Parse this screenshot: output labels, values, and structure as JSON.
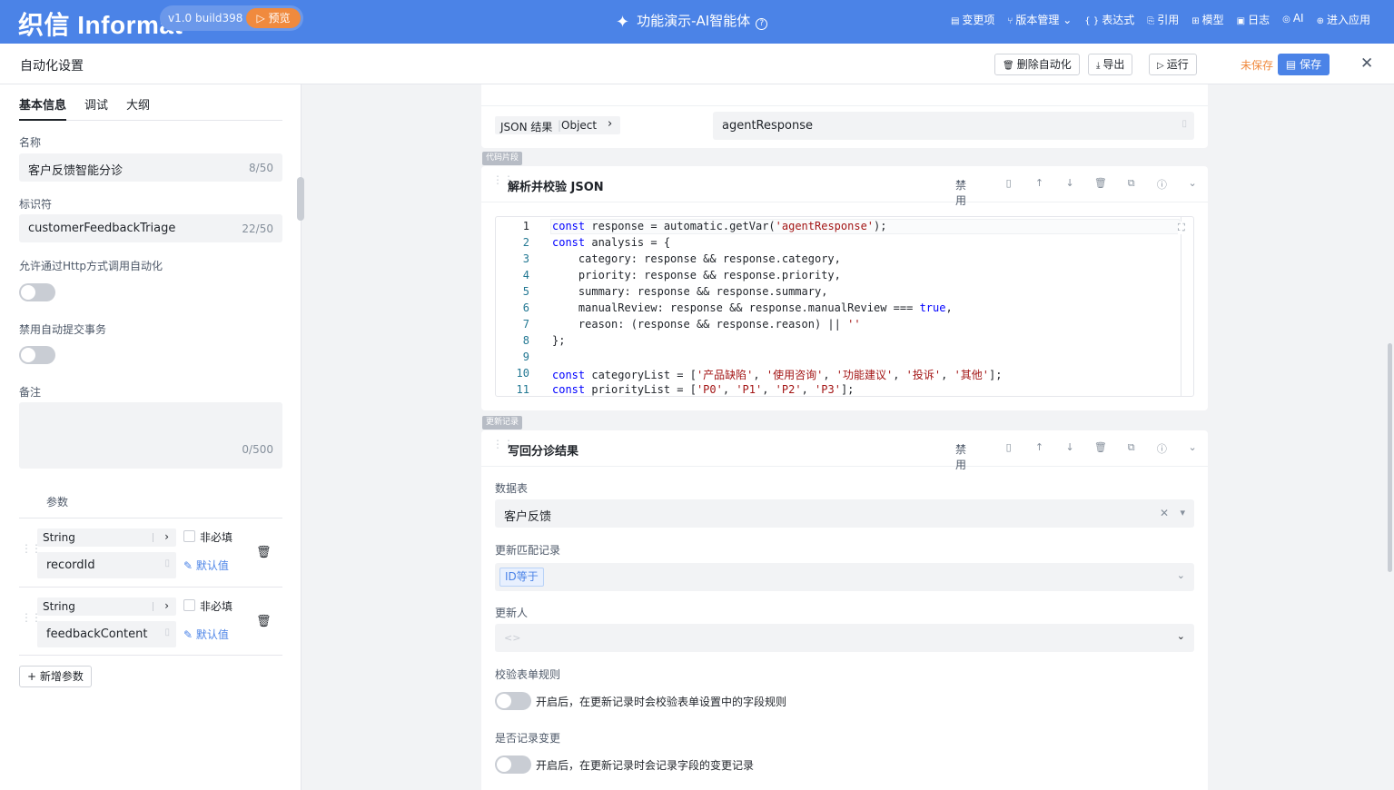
{
  "app": {
    "logo": "织信 Informat",
    "version": "v1.0 build398",
    "preview": "▷ 预览",
    "title": "功能演示-AI智能体"
  },
  "topnav": [
    {
      "icon": "list-icon",
      "glyph": "▤",
      "label": "变更项"
    },
    {
      "icon": "branch-icon",
      "glyph": "⑂",
      "label": "版本管理 ⌄"
    },
    {
      "icon": "braces-icon",
      "glyph": "{ }",
      "label": "表达式"
    },
    {
      "icon": "link-icon",
      "glyph": "⎘",
      "label": "引用"
    },
    {
      "icon": "grid-icon",
      "glyph": "⊞",
      "label": "模型"
    },
    {
      "icon": "image-icon",
      "glyph": "▣",
      "label": "日志"
    },
    {
      "icon": "ai-icon",
      "glyph": "◎",
      "label": "AI"
    },
    {
      "icon": "enter-icon",
      "glyph": "⊕",
      "label": "进入应用"
    }
  ],
  "header": {
    "title": "自动化设置",
    "delete": "删除自动化",
    "export": "导出",
    "run": "运行",
    "unsaved": "未保存",
    "save": "保存"
  },
  "tabs": [
    "基本信息",
    "调试",
    "大纲"
  ],
  "form": {
    "name_label": "名称",
    "name": "客户反馈智能分诊",
    "name_count": "8/50",
    "id_label": "标识符",
    "id": "customerFeedbackTriage",
    "id_count": "22/50",
    "http_label": "允许通过Http方式调用自动化",
    "http_enabled": false,
    "autocommit_label": "禁用自动提交事务",
    "autocommit_disabled": false,
    "remark_label": "备注",
    "remark": "",
    "remark_count": "0/500"
  },
  "params": {
    "title": "参数",
    "add": "+ 新增参数",
    "optional": "非必填",
    "default": "✎ 默认值",
    "items": [
      {
        "type": "String",
        "name": "recordId"
      },
      {
        "type": "String",
        "name": "feedbackContent"
      }
    ]
  },
  "card0": {
    "json_label": "JSON 结果",
    "json_type": "Object",
    "value": "agentResponse"
  },
  "card1": {
    "tag": "代码片段",
    "title": "解析并校验 JSON",
    "disable": "禁用"
  },
  "code": [
    {
      "n": "1",
      "segs": [
        [
          "kw",
          "const"
        ],
        [
          "",
          "response = automatic.getVar("
        ],
        [
          "st",
          "'agentResponse'"
        ],
        [
          "",
          ");"
        ]
      ]
    },
    {
      "n": "2",
      "segs": [
        [
          "kw",
          "const"
        ],
        [
          "",
          "analysis = {"
        ]
      ]
    },
    {
      "n": "3",
      "segs": [
        [
          "",
          "    category: response && response.category,"
        ]
      ]
    },
    {
      "n": "4",
      "segs": [
        [
          "",
          "    priority: response && response.priority,"
        ]
      ]
    },
    {
      "n": "5",
      "segs": [
        [
          "",
          "    summary: response && response.summary,"
        ]
      ]
    },
    {
      "n": "6",
      "segs": [
        [
          "",
          "    manualReview: response && response.manualReview === "
        ],
        [
          "kw",
          "true"
        ],
        [
          "",
          ","
        ]
      ]
    },
    {
      "n": "7",
      "segs": [
        [
          "",
          "    reason: (response && response.reason) || "
        ],
        [
          "st",
          "''"
        ]
      ]
    },
    {
      "n": "8",
      "segs": [
        [
          "",
          "};"
        ]
      ]
    },
    {
      "n": "9",
      "segs": []
    },
    {
      "n": "10",
      "segs": [
        [
          "kw",
          "const"
        ],
        [
          "",
          "categoryList = ["
        ],
        [
          "st",
          "'产品缺陷'"
        ],
        [
          "",
          ", "
        ],
        [
          "st",
          "'使用咨询'"
        ],
        [
          "",
          ", "
        ],
        [
          "st",
          "'功能建议'"
        ],
        [
          "",
          ", "
        ],
        [
          "st",
          "'投诉'"
        ],
        [
          "",
          ", "
        ],
        [
          "st",
          "'其他'"
        ],
        [
          "",
          "];"
        ]
      ]
    },
    {
      "n": "11",
      "segs": [
        [
          "kw",
          "const"
        ],
        [
          "",
          "priorityList = ["
        ],
        [
          "st",
          "'P0'"
        ],
        [
          "",
          ", "
        ],
        [
          "st",
          "'P1'"
        ],
        [
          "",
          ", "
        ],
        [
          "st",
          "'P2'"
        ],
        [
          "",
          ", "
        ],
        [
          "st",
          "'P3'"
        ],
        [
          "",
          "];"
        ]
      ]
    }
  ],
  "card2": {
    "tag": "更新记录",
    "title": "写回分诊结果",
    "disable": "禁用",
    "table_label": "数据表",
    "table": "客户反馈",
    "match_label": "更新匹配记录",
    "match_tag": "ID等于",
    "updater_label": "更新人",
    "updater_placeholder": "<>",
    "validate_label": "校验表单规则",
    "validate_desc": "开启后，在更新记录时会校验表单设置中的字段规则",
    "log_label": "是否记录变更",
    "log_desc": "开启后，在更新记录时会记录字段的变更记录"
  }
}
